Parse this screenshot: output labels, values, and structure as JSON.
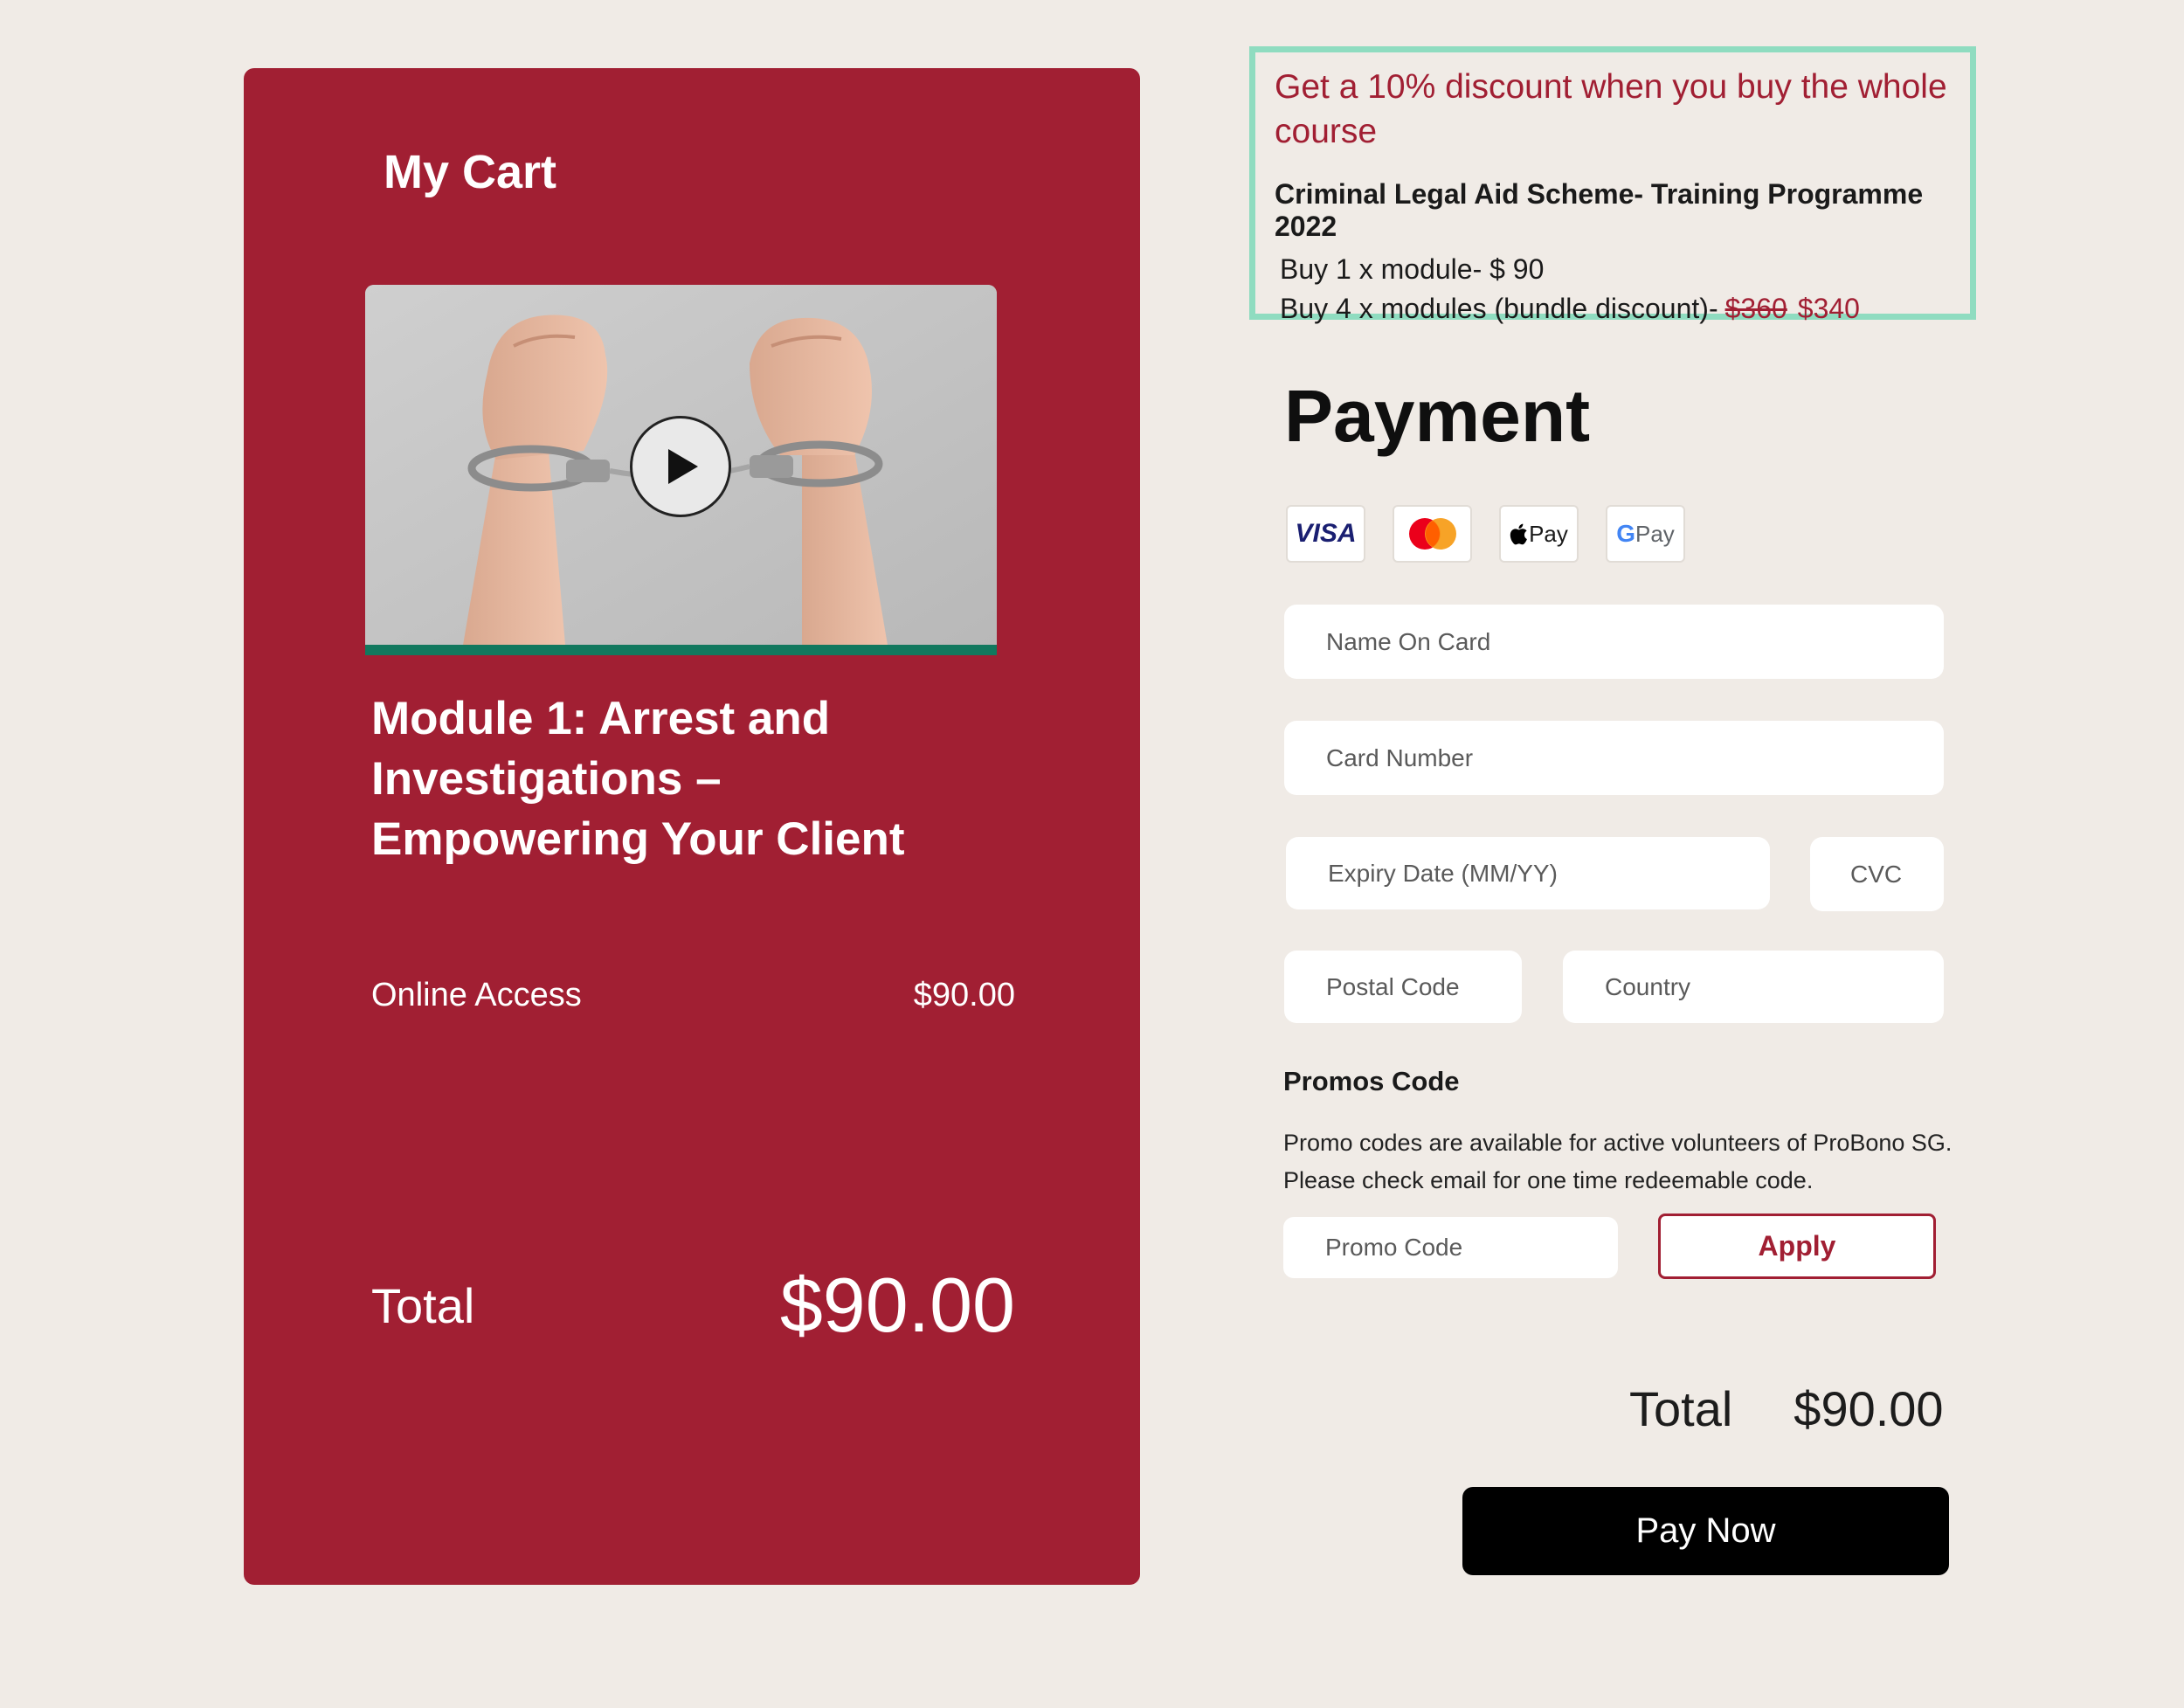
{
  "cart": {
    "title": "My Cart",
    "module_title": "Module 1: Arrest and Investigations – Empowering Your Client",
    "access_label": "Online Access",
    "access_price": "$90.00",
    "total_label": "Total",
    "total_value": "$90.00",
    "video": {
      "progress": 1.0,
      "image": "hands-in-handcuffs",
      "play_icon": "play-icon"
    }
  },
  "promo": {
    "headline": "Get a 10% discount when you buy the whole course",
    "course_name": "Criminal Legal Aid Scheme- Training Programme 2022",
    "line1": "Buy 1 x module- $ 90",
    "line2_prefix": "Buy 4 x modules (bundle discount)-",
    "line2_old": "$360",
    "line2_new": "$340",
    "border_color": "#8fdcc0"
  },
  "payment": {
    "title": "Payment",
    "methods": [
      {
        "name": "visa",
        "label": "VISA"
      },
      {
        "name": "mastercard",
        "label": ""
      },
      {
        "name": "apple-pay",
        "label": "Pay"
      },
      {
        "name": "google-pay",
        "label": "Pay"
      }
    ],
    "fields": {
      "name_on_card": {
        "placeholder": "Name On Card",
        "value": ""
      },
      "card_number": {
        "placeholder": "Card Number",
        "value": ""
      },
      "expiry": {
        "placeholder": "Expiry Date (MM/YY)",
        "value": ""
      },
      "cvc": {
        "placeholder": "CVC",
        "value": ""
      },
      "postal_code": {
        "placeholder": "Postal Code",
        "value": ""
      },
      "country": {
        "placeholder": "Country",
        "value": ""
      }
    },
    "promo_heading": "Promos Code",
    "promo_desc_1": "Promo codes are available for active volunteers of ProBono SG.",
    "promo_desc_2": "Please check email for one time redeemable code.",
    "promo_input": {
      "placeholder": "Promo Code",
      "value": ""
    },
    "apply_label": "Apply",
    "total_label": "Total",
    "total_value": "$90.00",
    "pay_label": "Pay Now"
  },
  "colors": {
    "brand": "#a11f33",
    "background": "#f0ebe6",
    "video_bar": "#11785e",
    "pay_button": "#000000"
  }
}
